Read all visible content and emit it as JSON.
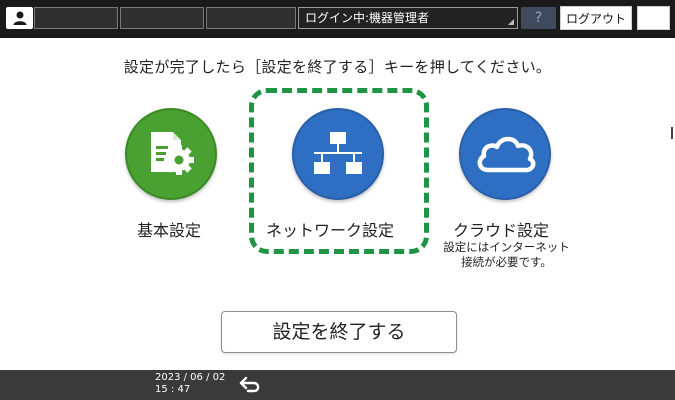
{
  "top_bar": {
    "login_status": "ログイン中:機器管理者",
    "help_label": "?",
    "logout_label": "ログアウト"
  },
  "instruction": "設定が完了したら［設定を終了する］キーを押してください。",
  "tiles": [
    {
      "label": "基本設定",
      "icon": "basic-settings-icon",
      "color": "#4aa030"
    },
    {
      "label": "ネットワーク設定",
      "icon": "network-icon",
      "color": "#2e6fc4",
      "selected": true
    },
    {
      "label": "クラウド設定",
      "icon": "cloud-icon",
      "color": "#2e6fc4",
      "note_line1": "設定にはインターネット",
      "note_line2": "接続が必要です。"
    }
  ],
  "finish_button": "設定を終了する",
  "bottom_bar": {
    "date": "2023 / 06 / 02",
    "time": "15 : 47"
  },
  "colors": {
    "focus_frame": "#1e9444",
    "top_bar": "#1a1a1a",
    "bottom_bar": "#3a3a3a"
  }
}
